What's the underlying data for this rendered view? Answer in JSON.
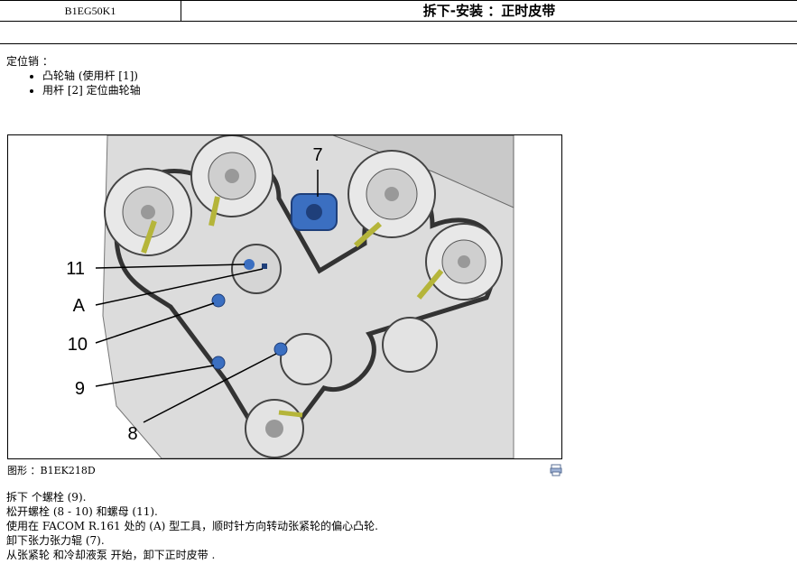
{
  "header": {
    "doc_code": "B1EG50K1",
    "title": "拆下-安装 ：正时皮带"
  },
  "intro": {
    "heading": "定位销 ：",
    "items": [
      "凸轮轴 (使用杆 [1])",
      "用杆 [2] 定位曲轮轴"
    ]
  },
  "figure": {
    "callouts": [
      "7",
      "11",
      "A",
      "10",
      "9",
      "8"
    ],
    "caption": "图形 ：B1EK218D",
    "print_icon": "print-icon"
  },
  "steps": [
    "拆下 个螺栓 (9).",
    "松开螺栓 (8 - 10) 和螺母 (11).",
    "使用在 FACOM R.161 处的 (A) 型工具，顺时针方向转动张紧轮的偏心凸轮.",
    "卸下张力张力辊 (7).",
    "从张紧轮 和冷却液泵 开始，卸下正时皮带 ."
  ]
}
